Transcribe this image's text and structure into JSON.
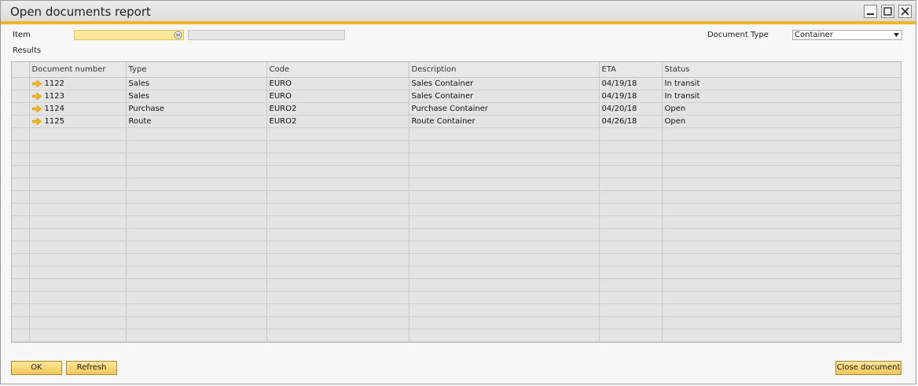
{
  "window": {
    "title": "Open documents report"
  },
  "filters": {
    "item_label": "Item",
    "item_value": "",
    "item_description": "",
    "document_type_label": "Document Type",
    "document_type_value": "Container"
  },
  "results": {
    "label": "Results",
    "columns": [
      "Document number",
      "Type",
      "Code",
      "Description",
      "ETA",
      "Status"
    ],
    "rows": [
      {
        "doc": "1122",
        "type": "Sales",
        "code": "EURO",
        "description": "Sales Container",
        "eta": "04/19/18",
        "status": "In transit"
      },
      {
        "doc": "1123",
        "type": "Sales",
        "code": "EURO",
        "description": "Sales Container",
        "eta": "04/19/18",
        "status": "In transit"
      },
      {
        "doc": "1124",
        "type": "Purchase",
        "code": "EURO2",
        "description": "Purchase Container",
        "eta": "04/20/18",
        "status": "Open"
      },
      {
        "doc": "1125",
        "type": "Route",
        "code": "EURO2",
        "description": "Route Container",
        "eta": "04/26/18",
        "status": "Open"
      }
    ]
  },
  "buttons": {
    "ok": "OK",
    "refresh": "Refresh",
    "close_document": "Close document"
  },
  "colors": {
    "accent": "#f0b429",
    "link_arrow": "#f2b90f",
    "item_field": "#fbe79a"
  }
}
